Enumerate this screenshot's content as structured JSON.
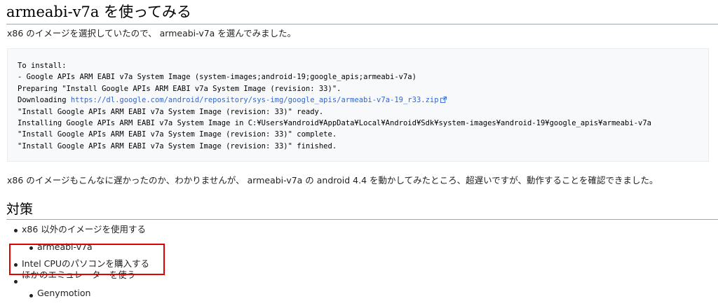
{
  "section_title": "armeabi-v7a を使ってみる",
  "intro_text": "x86 のイメージを選択していたので、 armeabi-v7a を選んでみました。",
  "code_block": {
    "line1": "To install:",
    "line2": "- Google APIs ARM EABI v7a System Image (system-images;android-19;google_apis;armeabi-v7a)",
    "line3": "Preparing \"Install Google APIs ARM EABI v7a System Image (revision: 33)\".",
    "line4_prefix": "Downloading ",
    "line4_link": "https://dl.google.com/android/repository/sys-img/google_apis/armeabi-v7a-19_r33.zip",
    "line5": "\"Install Google APIs ARM EABI v7a System Image (revision: 33)\" ready.",
    "line6": "Installing Google APIs ARM EABI v7a System Image in C:¥Users¥android¥AppData¥Local¥Android¥Sdk¥system-images¥android-19¥google_apis¥armeabi-v7a",
    "line7": "\"Install Google APIs ARM EABI v7a System Image (revision: 33)\" complete.",
    "line8": "\"Install Google APIs ARM EABI v7a System Image (revision: 33)\" finished."
  },
  "result_text": "x86 のイメージもこんなに遅かったのか、わかりませんが、 armeabi-v7a の android 4.4 を動かしてみたところ、超遅いですが、動作することを確認できました。",
  "subsection_title": "対策",
  "list": {
    "item1": "x86 以外のイメージを使用する",
    "item1_sub": "armeabi-v7a",
    "item2": "Intel CPUのパソコンを購入する",
    "item3": "ほかのエミュレーターを使う",
    "item3_sub": "Genymotion"
  },
  "colors": {
    "link": "#3366cc",
    "highlight_box": "#e00000",
    "code_background": "#f8f9fa"
  }
}
